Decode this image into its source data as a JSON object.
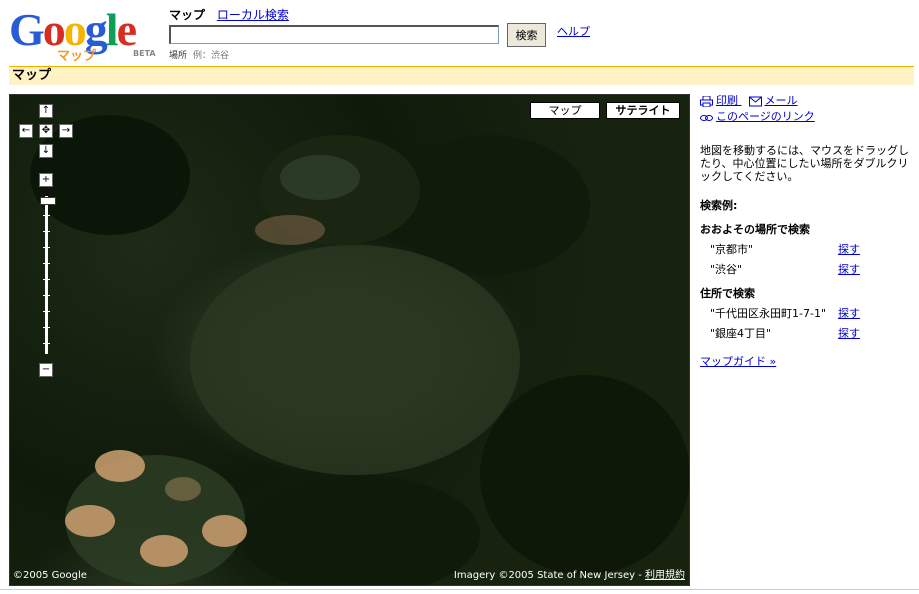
{
  "logo": {
    "word": "Google",
    "sub": "マップ",
    "beta": "BETA"
  },
  "tabs": {
    "current": "マップ",
    "local": "ローカル検索"
  },
  "search": {
    "value": "",
    "button": "検索"
  },
  "help": "ヘルプ",
  "hint": {
    "label": "場所",
    "example": "例：渋谷"
  },
  "title": "マップ",
  "map": {
    "type_buttons": {
      "map": "マップ",
      "satellite": "サテライト"
    },
    "selected_type": "satellite",
    "copyright": "©2005 Google",
    "imagery": "Imagery ©2005 State of New Jersey - ",
    "terms": "利用規約",
    "controls": {
      "up": "↑",
      "down": "↓",
      "left": "←",
      "right": "→",
      "zoom_in": "+",
      "zoom_out": "−"
    }
  },
  "sidebar": {
    "print": "印刷",
    "email": "メール",
    "link": "このページのリンク",
    "help_text": "地図を移動するには、マウスをドラッグしたり、中心位置にしたい場所をダブルクリックしてください。",
    "examples_title": "検索例:",
    "groups": [
      {
        "title": "おおよその場所で検索",
        "items": [
          {
            "q": "\"京都市\"",
            "action": "探す"
          },
          {
            "q": "\"渋谷\"",
            "action": "探す"
          }
        ]
      },
      {
        "title": "住所で検索",
        "items": [
          {
            "q": "\"千代田区永田町1-7-1\"",
            "action": "探す"
          },
          {
            "q": "\"銀座4丁目\"",
            "action": "探す"
          }
        ]
      }
    ],
    "guide": "マップガイド »"
  },
  "colors": {
    "accent": "#fff3c6",
    "link": "#0000cc",
    "title_border": "#f0b000"
  }
}
